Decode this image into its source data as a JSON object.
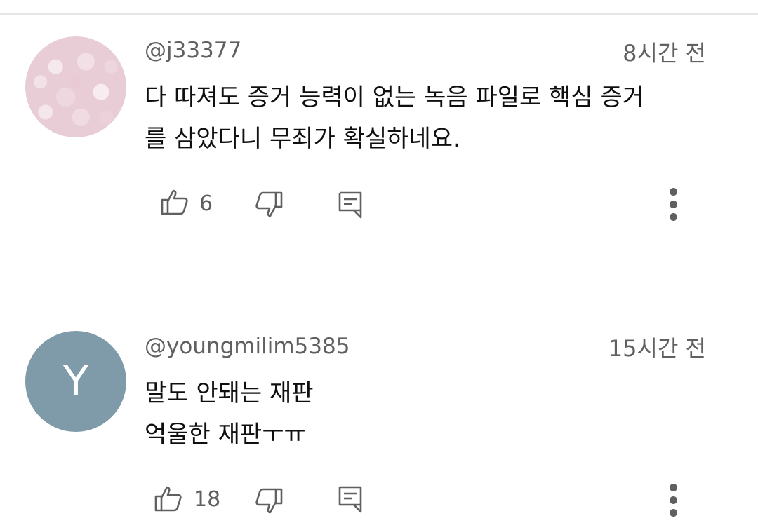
{
  "comments": [
    {
      "handle": "@j33377",
      "time": "8시간 전",
      "text": "다 따져도 증거 능력이 없는 녹음 파일로 핵심 증거\n를 삼았다니 무죄가 확실하네요.",
      "likes": "6",
      "avatar": {
        "type": "image",
        "description_icon": "flower-avatar"
      }
    },
    {
      "handle": "@youngmilim5385",
      "time": "15시간 전",
      "text": "말도 안돼는 재판\n억울한 재판ㅜㅠ",
      "likes": "18",
      "avatar": {
        "type": "letter",
        "letter": "Y",
        "color": "#7f9aa8"
      }
    }
  ],
  "icons": {
    "like": "thumbs-up-icon",
    "dislike": "thumbs-down-icon",
    "reply": "reply-icon",
    "more": "more-vertical-icon"
  },
  "colors": {
    "text_primary": "#0f0f0f",
    "text_secondary": "#606060",
    "divider": "#e5e5e5"
  }
}
